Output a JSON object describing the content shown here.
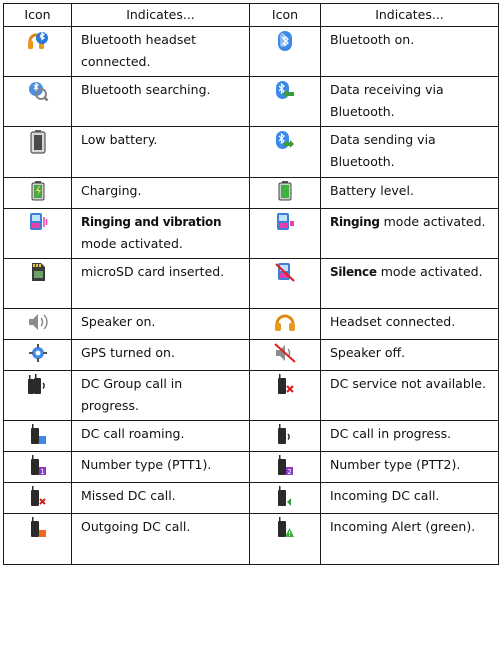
{
  "table": {
    "headers": [
      "Icon",
      "Indicates...",
      "Icon",
      "Indicates..."
    ],
    "rows": [
      {
        "left": {
          "icon": "bluetooth-headset-connected-icon",
          "text": "Bluetooth headset connected."
        },
        "right": {
          "icon": "bluetooth-on-icon",
          "text": "Bluetooth on."
        }
      },
      {
        "left": {
          "icon": "bluetooth-searching-icon",
          "text": "Bluetooth searching."
        },
        "right": {
          "icon": "bluetooth-data-receiving-icon",
          "text": "Data receiving via Bluetooth."
        }
      },
      {
        "left": {
          "icon": "low-battery-icon",
          "text": "Low battery."
        },
        "right": {
          "icon": "bluetooth-data-sending-icon",
          "text": "Data sending via Bluetooth."
        }
      },
      {
        "left": {
          "icon": "charging-icon",
          "text": "Charging."
        },
        "right": {
          "icon": "battery-level-icon",
          "text": "Battery level."
        }
      },
      {
        "left": {
          "icon": "ringing-vibration-icon",
          "bold": "Ringing and vibration",
          "text": "mode activated."
        },
        "right": {
          "icon": "ringing-mode-icon",
          "bold": "Ringing",
          "text": "mode activated."
        }
      },
      {
        "left": {
          "icon": "microsd-card-icon",
          "text": "microSD card inserted."
        },
        "right": {
          "icon": "silence-mode-icon",
          "bold": "Silence",
          "text": "mode activated."
        }
      },
      {
        "left": {
          "icon": "speaker-on-icon",
          "text": "Speaker on."
        },
        "right": {
          "icon": "headset-connected-icon",
          "text": "Headset connected."
        }
      },
      {
        "left": {
          "icon": "gps-on-icon",
          "text": "GPS turned on."
        },
        "right": {
          "icon": "speaker-off-icon",
          "text": "Speaker off."
        }
      },
      {
        "left": {
          "icon": "dc-group-call-icon",
          "text": "DC Group call in progress."
        },
        "right": {
          "icon": "dc-service-unavailable-icon",
          "text": "DC service not available."
        }
      },
      {
        "left": {
          "icon": "dc-call-roaming-icon",
          "text": "DC call roaming."
        },
        "right": {
          "icon": "dc-call-in-progress-icon",
          "text": "DC call in progress."
        }
      },
      {
        "left": {
          "icon": "number-type-ptt1-icon",
          "text": "Number type (PTT1)."
        },
        "right": {
          "icon": "number-type-ptt2-icon",
          "text": "Number type (PTT2)."
        }
      },
      {
        "left": {
          "icon": "missed-dc-call-icon",
          "text": "Missed DC call."
        },
        "right": {
          "icon": "incoming-dc-call-icon",
          "text": "Incoming DC call."
        }
      },
      {
        "left": {
          "icon": "outgoing-dc-call-icon",
          "text": "Outgoing DC call."
        },
        "right": {
          "icon": "incoming-alert-green-icon",
          "text": "Incoming Alert (green)."
        }
      }
    ]
  }
}
